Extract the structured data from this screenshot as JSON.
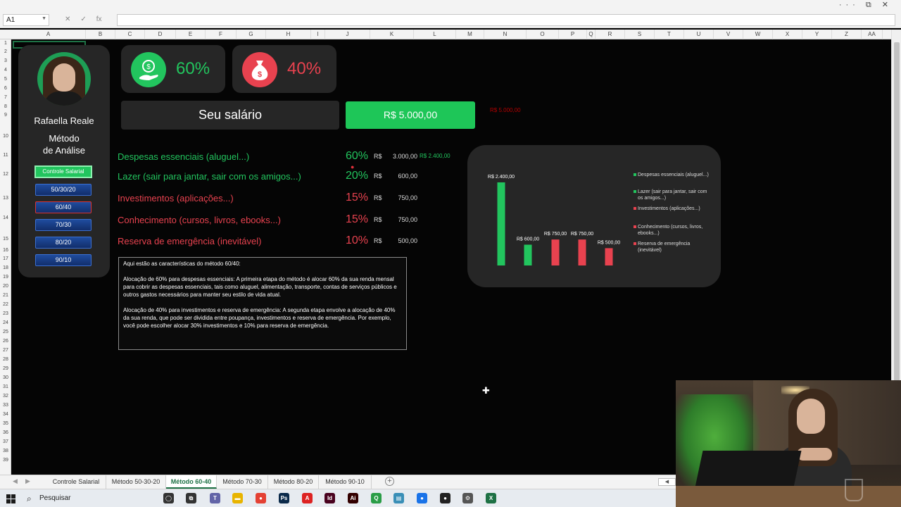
{
  "excel": {
    "window_controls": "··· ⧉ ✕",
    "name_box": "A1",
    "fx_icons": [
      "✕",
      "✓",
      "fx"
    ],
    "columns": [
      "A",
      "B",
      "C",
      "D",
      "E",
      "F",
      "G",
      "H",
      "I",
      "J",
      "K",
      "L",
      "M",
      "N",
      "O",
      "P",
      "Q",
      "R",
      "S",
      "T",
      "U",
      "V",
      "W",
      "X",
      "Y",
      "Z",
      "AA"
    ],
    "rows": [
      "1",
      "2",
      "3",
      "4",
      "5",
      "6",
      "7",
      "8",
      "9",
      "10",
      "11",
      "12",
      "13",
      "14",
      "15",
      "16",
      "17",
      "18",
      "19",
      "20",
      "21",
      "22",
      "23",
      "24",
      "25",
      "26",
      "27",
      "28",
      "29",
      "30",
      "31",
      "32",
      "33",
      "34",
      "35",
      "36",
      "37",
      "38",
      "39"
    ]
  },
  "sidebar": {
    "name": "Rafaella Reale",
    "method_title": "Método\nde Análise",
    "controle_button": "Controle Salarial",
    "method_buttons": [
      "50/30/20",
      "60/40",
      "70/30",
      "80/20",
      "90/10"
    ],
    "active_method": "60/40"
  },
  "cards": {
    "pct_green": "60%",
    "pct_red": "40%",
    "salary_label": "Seu salário",
    "salary_value": "R$ 5.000,00",
    "salary_faint": "R$   5.000,00"
  },
  "expenses": [
    {
      "label": "Despesas essenciais (aluguel...)",
      "pct": "60%",
      "currency": "R$",
      "value": "3.000,00",
      "extra": "R$ 2.400,00",
      "color": "#22c55e"
    },
    {
      "label": "Lazer (sair para jantar, sair com os amigos...)",
      "pct": "20%",
      "currency": "R$",
      "value": "600,00",
      "extra": "",
      "color": "#22c55e"
    },
    {
      "label": "Investimentos (aplicações...)",
      "pct": "15%",
      "currency": "R$",
      "value": "750,00",
      "extra": "",
      "color": "#e8424f"
    },
    {
      "label": "Conhecimento (cursos, livros, ebooks...)",
      "pct": "15%",
      "currency": "R$",
      "value": "750,00",
      "extra": "",
      "color": "#e8424f"
    },
    {
      "label": "Reserva de emergência (inevitável)",
      "pct": "10%",
      "currency": "R$",
      "value": "500,00",
      "extra": "",
      "color": "#e8424f"
    }
  ],
  "description": {
    "title": "Aqui estão as características do método 60/40:",
    "p1": "Alocação de 60% para despesas essenciais: A primeira etapa do método é alocar 60% da sua renda mensal para cobrir as despesas essenciais, tais como aluguel, alimentação, transporte, contas de serviços públicos e outros gastos necessários para manter seu estilo de vida atual.",
    "p2": "Alocação de 40% para investimentos e reserva de emergência: A segunda etapa envolve a alocação de 40% da sua renda, que pode ser dividida entre poupança, investimentos e reserva de emergência. Por exemplo, você pode escolher alocar 30% investimentos e 10% para reserva de emergência."
  },
  "chart_data": {
    "type": "bar",
    "categories": [
      "Despesas essenciais (aluguel...)",
      "Lazer (sair para jantar, sair com os amigos...)",
      "Investimentos (aplicações...)",
      "Conhecimento (cursos, livros, ebooks...)",
      "Reserva de emergência (inevitável)"
    ],
    "values": [
      2400,
      600,
      750,
      750,
      500
    ],
    "data_labels": [
      "R$ 2.400,00",
      "R$ 600,00",
      "R$ 750,00",
      "R$ 750,00",
      "R$ 500,00"
    ],
    "colors": [
      "#22c55e",
      "#22c55e",
      "#e8424f",
      "#e8424f",
      "#e8424f"
    ],
    "legend": [
      "Despesas essenciais (aluguel...)",
      "Lazer (sair para jantar, sair com os amigos...)",
      "Investimentos (aplicações...)",
      "Conhecimento (cursos, livros, ebooks...)",
      "Reserva de emergência (inevitável)"
    ],
    "legend_position": "right",
    "grid": false,
    "ylim": [
      0,
      2400
    ],
    "title": "",
    "xlabel": "",
    "ylabel": ""
  },
  "tabs": [
    "Controle Salarial",
    "Método 50-30-20",
    "Método 60-40",
    "Método 70-30",
    "Método 80-20",
    "Método 90-10"
  ],
  "active_tab": "Método 60-40",
  "taskbar": {
    "search_label": "Pesquisar",
    "apps": [
      {
        "name": "task-view",
        "glyph": "◯",
        "color": "#333333"
      },
      {
        "name": "multitask",
        "glyph": "⧉",
        "color": "#333333"
      },
      {
        "name": "teams",
        "glyph": "T",
        "color": "#6264a7"
      },
      {
        "name": "explorer",
        "glyph": "▬",
        "color": "#e8b400"
      },
      {
        "name": "chrome",
        "glyph": "●",
        "color": "#e44134"
      },
      {
        "name": "photoshop",
        "glyph": "Ps",
        "color": "#0b2a4a"
      },
      {
        "name": "acrobat",
        "glyph": "A",
        "color": "#d22"
      },
      {
        "name": "indesign",
        "glyph": "Id",
        "color": "#49021f"
      },
      {
        "name": "illustrator",
        "glyph": "Ai",
        "color": "#330000"
      },
      {
        "name": "qlik",
        "glyph": "Q",
        "color": "#2a9d47"
      },
      {
        "name": "sheets",
        "glyph": "▤",
        "color": "#3a8fb7"
      },
      {
        "name": "chrome2",
        "glyph": "●",
        "color": "#1a73e8"
      },
      {
        "name": "obs",
        "glyph": "●",
        "color": "#222222"
      },
      {
        "name": "settings",
        "glyph": "⚙",
        "color": "#555555"
      },
      {
        "name": "excel",
        "glyph": "X",
        "color": "#1e7145"
      }
    ]
  }
}
